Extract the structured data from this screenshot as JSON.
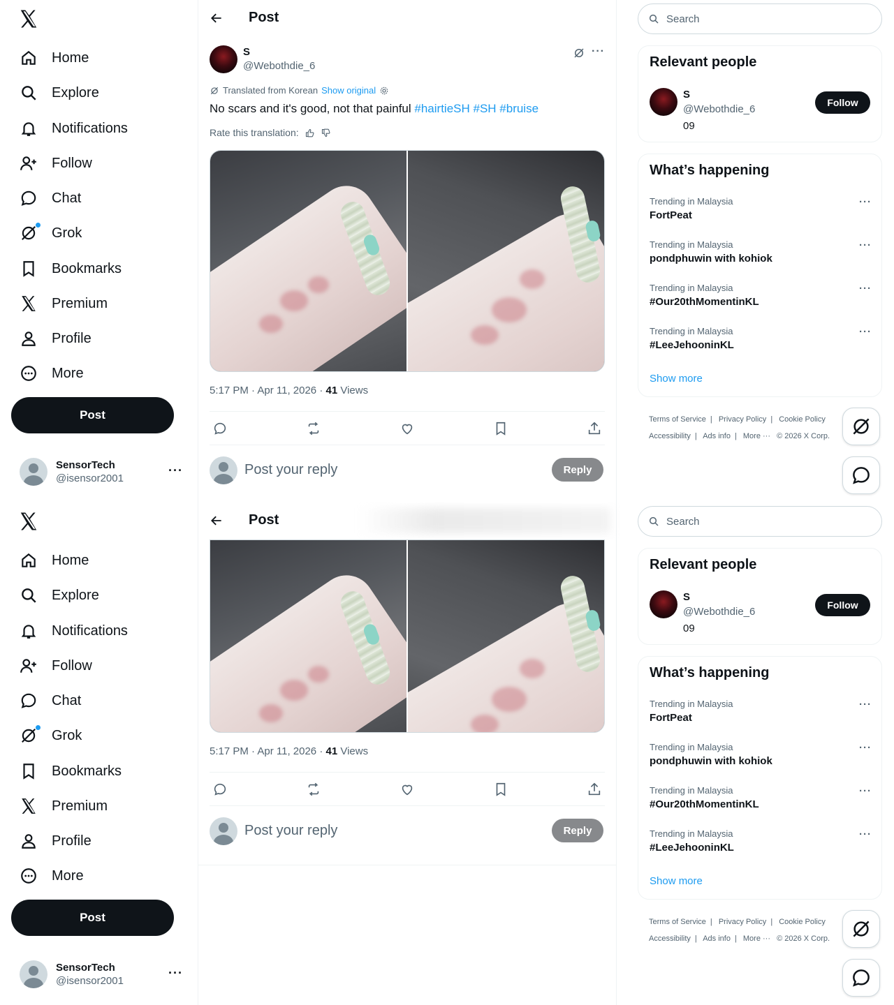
{
  "nav": {
    "items": [
      {
        "label": "Home",
        "icon": "home-icon"
      },
      {
        "label": "Explore",
        "icon": "search-icon"
      },
      {
        "label": "Notifications",
        "icon": "bell-icon"
      },
      {
        "label": "Follow",
        "icon": "person-add-icon"
      },
      {
        "label": "Chat",
        "icon": "chat-icon"
      },
      {
        "label": "Grok",
        "icon": "grok-icon"
      },
      {
        "label": "Bookmarks",
        "icon": "bookmark-icon"
      },
      {
        "label": "Premium",
        "icon": "x-logo-icon"
      },
      {
        "label": "Profile",
        "icon": "person-icon"
      },
      {
        "label": "More",
        "icon": "more-circle-icon"
      }
    ],
    "post_button": "Post",
    "account": {
      "name": "SensorTech",
      "handle": "@isensor2001",
      "more": "···"
    }
  },
  "header": {
    "title": "Post"
  },
  "tweet": {
    "author_name": "S",
    "author_handle": "@Webothdie_6",
    "translated_label": "Translated from Korean",
    "show_original": "Show original",
    "text": "No scars and it's good, not that painful",
    "hashtags": "#hairtieSH #SH #bruise",
    "rate_label": "Rate this translation:",
    "timestamp": "5:17 PM · Apr 11, 2026 · ",
    "views_count": "41",
    "views_label": " Views",
    "more": "···"
  },
  "reply": {
    "placeholder": "Post your reply",
    "button": "Reply"
  },
  "sidebar": {
    "search_placeholder": "Search",
    "relevant_people": {
      "title": "Relevant people",
      "name": "S",
      "handle": "@Webothdie_6",
      "bio": "09",
      "follow": "Follow"
    },
    "trends": {
      "title": "What’s happening",
      "items": [
        {
          "context": "Trending in Malaysia",
          "name": "FortPeat"
        },
        {
          "context": "Trending in Malaysia",
          "name": "pondphuwin with kohiok"
        },
        {
          "context": "Trending in Malaysia",
          "name": "#Our20thMomentinKL"
        },
        {
          "context": "Trending in Malaysia",
          "name": "#LeeJehooninKL"
        }
      ],
      "show_more": "Show more",
      "more": "···"
    },
    "footer": {
      "terms": "Terms of Service",
      "privacy": "Privacy Policy",
      "cookie": "Cookie Policy",
      "accessibility": "Accessibility",
      "ads": "Ads info",
      "more": "More ···",
      "copyright": "© 2026 X Corp.",
      "sep": "|"
    }
  }
}
